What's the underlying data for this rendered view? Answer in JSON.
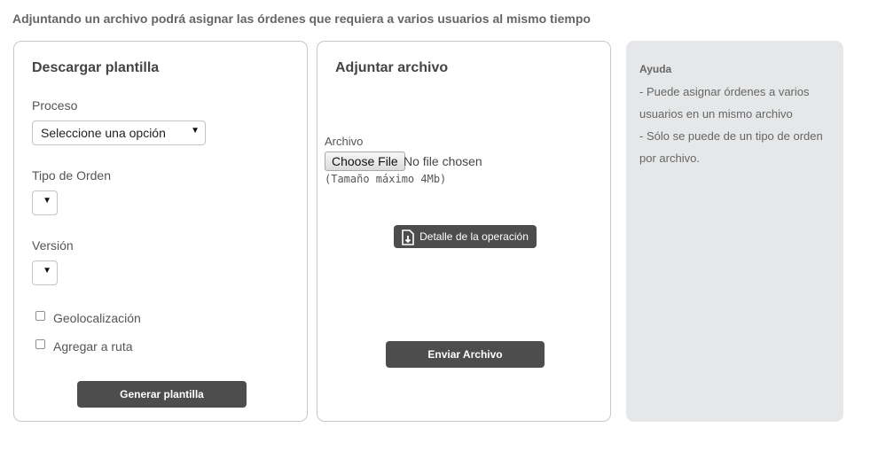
{
  "intro_text": "Adjuntando un archivo podrá asignar las órdenes que requiera a varios usuarios al mismo tiempo",
  "download_panel": {
    "title": "Descargar plantilla",
    "proceso_label": "Proceso",
    "proceso_selected": "Seleccione una opción",
    "tipo_orden_label": "Tipo de Orden",
    "tipo_orden_selected": "",
    "version_label": "Versión",
    "version_selected": "",
    "geolocalizacion_label": "Geolocalización",
    "agregar_ruta_label": "Agregar a ruta",
    "generate_button": "Generar plantilla"
  },
  "upload_panel": {
    "title": "Adjuntar archivo",
    "archivo_label": "Archivo",
    "choose_file_button": "Choose File",
    "file_status": "No file chosen",
    "size_note": "(Tamaño máximo 4Mb)",
    "detail_button": "Detalle de la operación",
    "send_button": "Enviar Archivo"
  },
  "help_panel": {
    "title": "Ayuda",
    "lines": [
      "- Puede asignar órdenes a varios",
      "usuarios en un mismo archivo",
      "- Sólo se puede de un tipo de orden",
      "por archivo."
    ]
  },
  "colors": {
    "dark_button": "#4d4d4d",
    "help_background": "#e6e7e8",
    "panel_border": "#c8c8c8"
  },
  "icons": {
    "select_arrow": "chevron-down-icon",
    "detail": "document-download-icon"
  }
}
